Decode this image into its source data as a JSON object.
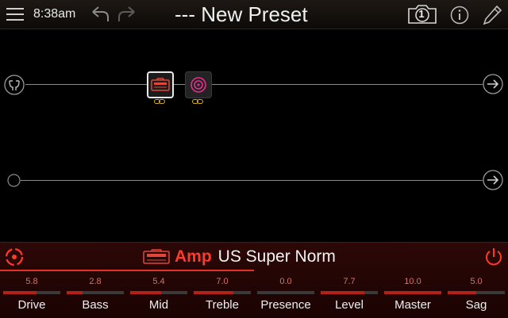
{
  "topbar": {
    "time": "8:38am",
    "preset_prefix": "---",
    "preset_name": "New Preset",
    "snapshot_number": "1"
  },
  "signal_flow": {
    "path1": {
      "blocks": [
        {
          "type": "amp",
          "selected": true
        },
        {
          "type": "cab",
          "selected": false
        }
      ]
    },
    "path2": {
      "blocks": []
    }
  },
  "block": {
    "category": "Amp",
    "model": "US Super Norm"
  },
  "params": [
    {
      "name": "Drive",
      "value": "5.8",
      "level": 0.58
    },
    {
      "name": "Bass",
      "value": "2.8",
      "level": 0.28
    },
    {
      "name": "Mid",
      "value": "5.4",
      "level": 0.54
    },
    {
      "name": "Treble",
      "value": "7.0",
      "level": 0.7
    },
    {
      "name": "Presence",
      "value": "0.0",
      "level": 0.0
    },
    {
      "name": "Level",
      "value": "7.7",
      "level": 0.77
    },
    {
      "name": "Master",
      "value": "10.0",
      "level": 1.0
    },
    {
      "name": "Sag",
      "value": "5.0",
      "level": 0.5
    }
  ],
  "colors": {
    "accent": "#ff3a2a",
    "topbar_bg": "#15110d",
    "footer_bg": "#250605",
    "amp_icon": "#e0473a",
    "cab_icon": "#e0308a",
    "link_icon": "#d8b020"
  }
}
